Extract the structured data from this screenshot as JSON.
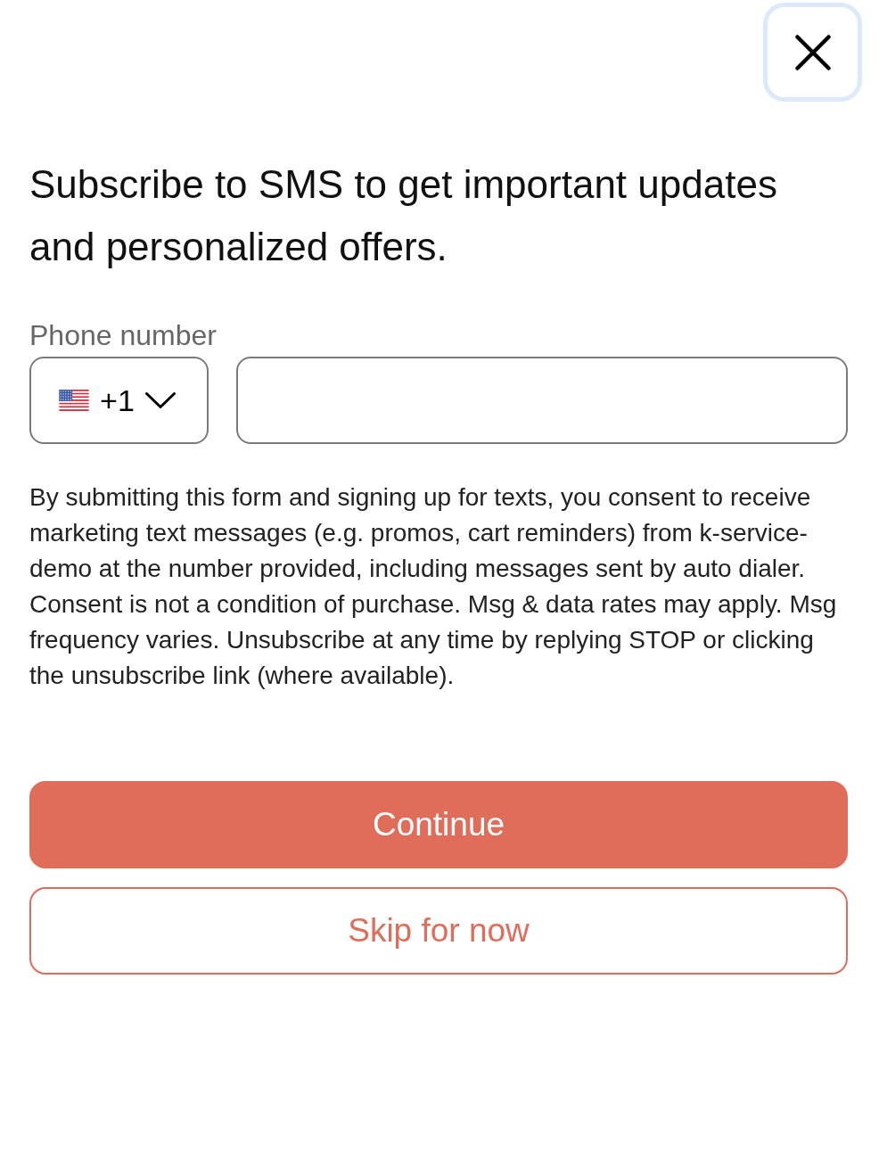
{
  "close_button": {
    "focused": true
  },
  "heading": "Subscribe to SMS to get important updates and personalized offers.",
  "phone": {
    "label": "Phone number",
    "country_code": "+1"
  },
  "consent_text": "By submitting this form and signing up for texts, you consent to receive marketing text messages (e.g. promos, cart reminders) from k-service-demo at the number provided, including messages sent by auto dialer. Consent is not a condition of purchase. Msg & data rates may apply. Msg frequency varies. Unsubscribe at any time by replying STOP or clicking the unsubscribe link (where available).",
  "buttons": [
    {
      "kind": "primary",
      "label": "Continue"
    },
    {
      "kind": "secondary",
      "label": "Skip for now"
    }
  ]
}
